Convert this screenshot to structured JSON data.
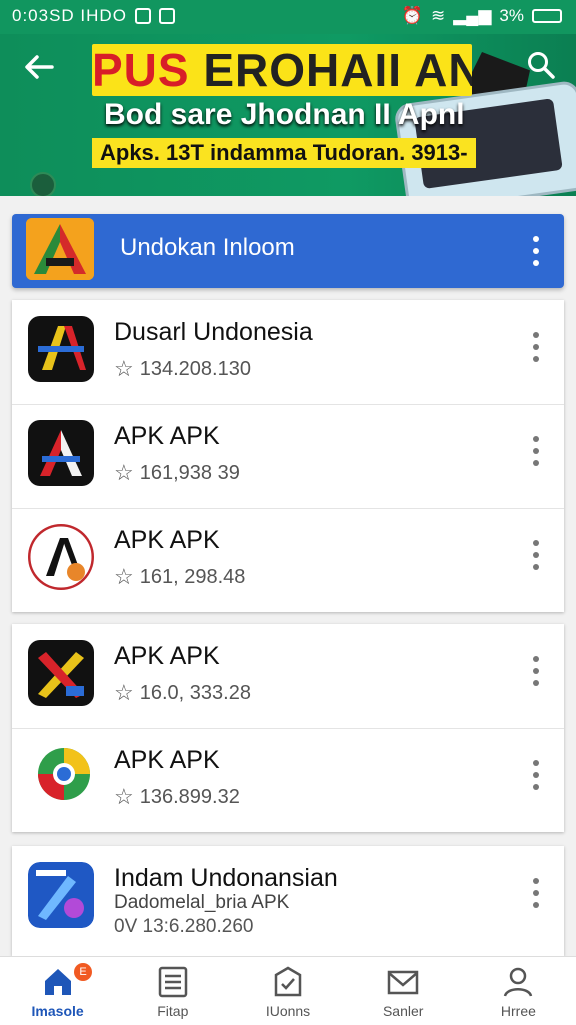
{
  "status_bar": {
    "left_text": "0:03SD IHDO",
    "battery": "3%"
  },
  "banner": {
    "title_part1": "PUS",
    "title_part2": "EROHAII AN",
    "subtitle": "Bod sare Jhodnan II Apnl",
    "strip": "Apks. 13T indamma Tudoran. 3913-"
  },
  "section": {
    "label": "Undokan Inloom"
  },
  "apps": [
    {
      "name": "Dusarl Undonesia",
      "stat": "134.208.130"
    },
    {
      "name": "APK APK",
      "stat": "161,938 39"
    },
    {
      "name": "APK APK",
      "stat": "161, 298.48"
    },
    {
      "name": "APK APK",
      "stat": "16.0, 333.28"
    },
    {
      "name": "APK APK",
      "stat": "136.899.32"
    },
    {
      "name": "Indam Undonansian",
      "line2": "Dadomelal_bria APK",
      "stat": "0V 13:6.280.260"
    }
  ],
  "nav": {
    "items": [
      {
        "label": "Imasole",
        "icon": "home-icon"
      },
      {
        "label": "Fitap",
        "icon": "list-icon"
      },
      {
        "label": "IUonns",
        "icon": "badge-check-icon"
      },
      {
        "label": "Sanler",
        "icon": "mail-icon"
      },
      {
        "label": "Hrree",
        "icon": "user-icon"
      }
    ],
    "badge": "E"
  },
  "colors": {
    "green": "#11965f",
    "blue": "#2f69d2",
    "yellow": "#fbe318"
  }
}
